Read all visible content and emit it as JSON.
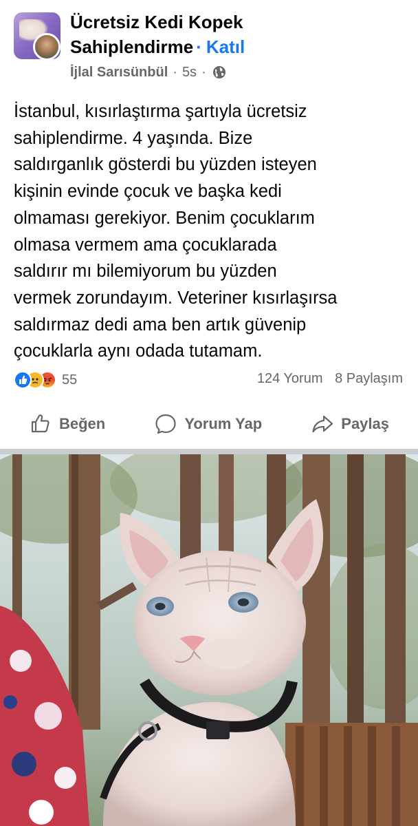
{
  "group": {
    "name_line1": "Ücretsiz Kedi Kopek",
    "name_line2": "Sahiplendirme",
    "join_separator": "·",
    "join_label": "Katıl"
  },
  "post_meta": {
    "author": "İjlal Sarısünbül",
    "separator": "·",
    "time": "5s",
    "audience_icon": "globe-icon"
  },
  "post": {
    "lines": [
      "İstanbul, kısırlaştırma şartıyla ücretsiz",
      "sahiplendirme. 4 yaşında. Bize",
      "saldırganlık gösterdi bu yüzden isteyen",
      "kişinin evinde çocuk ve başka kedi",
      "olmaması gerekiyor. Benim çocuklarım",
      "olmasa vermem ama çocuklarada",
      "saldırır mı bilemiyorum bu yüzden",
      "vermek zorundayım. Veteriner kısırlaşırsa",
      "saldırmaz dedi ama ben artık güvenip",
      "çocuklarla aynı odada tutamam."
    ]
  },
  "stats": {
    "reactions": [
      "like",
      "sad",
      "angry"
    ],
    "reaction_count": "55",
    "comments": "124 Yorum",
    "shares": "8 Paylaşım"
  },
  "actions": {
    "like_label": "Beğen",
    "comment_label": "Yorum Yap",
    "share_label": "Paylaş"
  },
  "colors": {
    "accent": "#1877f2",
    "secondary_text": "#65676b",
    "divider": "#c9ccd1"
  }
}
